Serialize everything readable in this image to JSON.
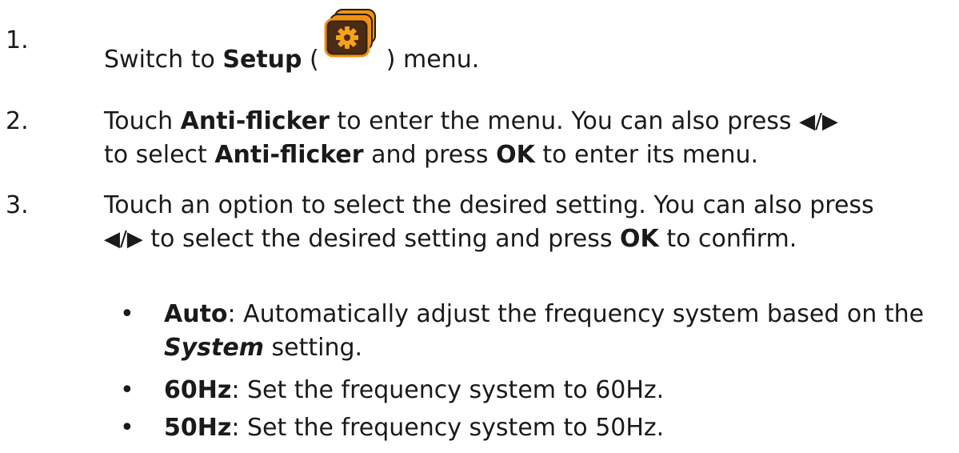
{
  "steps": [
    {
      "num": "1.",
      "pre": "Switch to ",
      "bold": "Setup",
      "open": " (",
      "close": ") menu.",
      "icon": "setup-gear-icon"
    },
    {
      "num": "2.",
      "line1_a": "Touch ",
      "line1_b": "Anti-flicker",
      "line1_c": " to enter the menu. You can also press ",
      "arrows": "◀/▶",
      "line2_a": "to select ",
      "line2_b": "Anti-flicker",
      "line2_c": " and press ",
      "line2_d": "OK",
      "line2_e": " to enter its menu."
    },
    {
      "num": "3.",
      "line1": "Touch an option to select the desired setting. You can also press",
      "arrows": "◀/▶",
      "line2_a": " to select the desired setting and press ",
      "line2_b": "OK",
      "line2_c": " to confirm."
    }
  ],
  "bullets": [
    {
      "dot": "•",
      "term": "Auto",
      "text_a": ": Automatically adjust the frequency system based on the ",
      "term2": "System",
      "text_b": " setting."
    },
    {
      "dot": "•",
      "term": "60Hz",
      "text": ": Set the frequency system to 60Hz."
    },
    {
      "dot": "•",
      "term": "50Hz",
      "text": ": Set the frequency system to 50Hz."
    }
  ],
  "colors": {
    "icon_orange": "#f29111",
    "icon_dark": "#3a2a1a",
    "gear": "#f5a21b",
    "text": "#1a1a1a"
  }
}
